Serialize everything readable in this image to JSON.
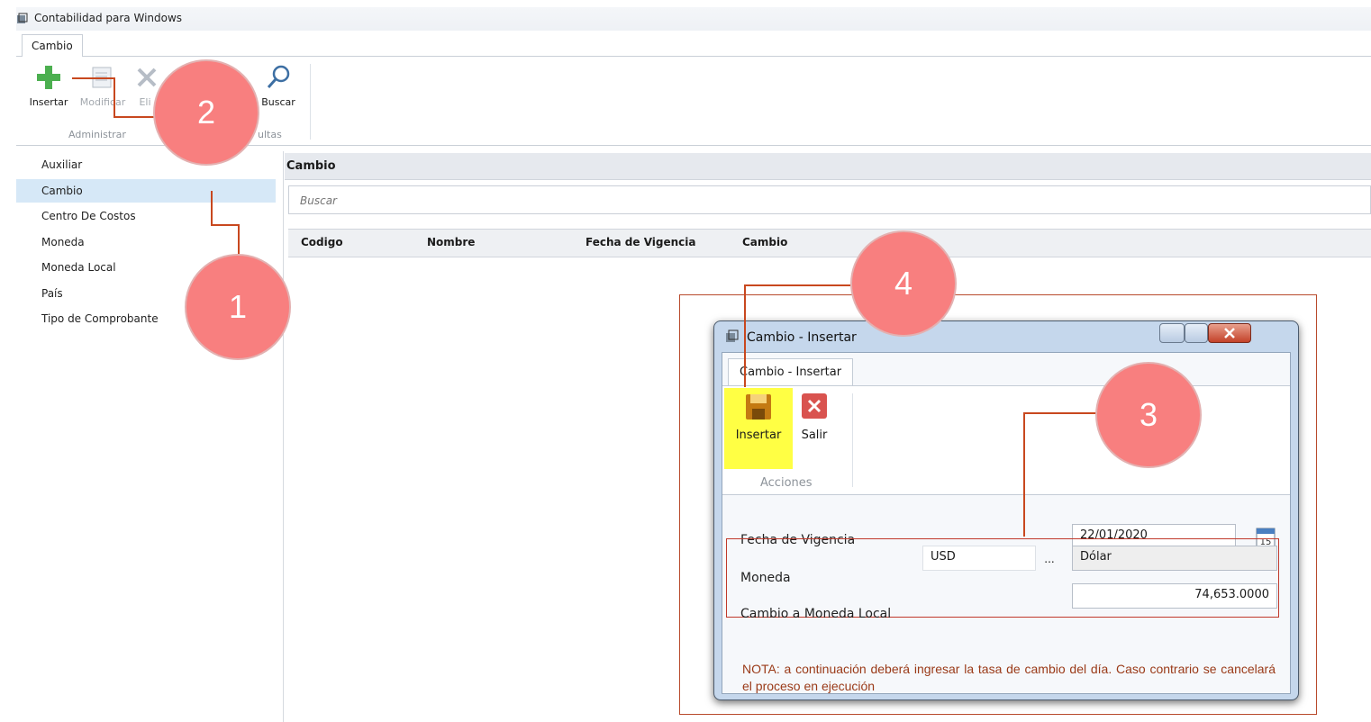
{
  "window": {
    "title": "Contabilidad para Windows"
  },
  "ribbon": {
    "tab": "Cambio",
    "buttons": {
      "insertar": "Insertar",
      "modificar": "Modificar",
      "eliminar": "Eli",
      "buscar": "Buscar"
    },
    "groups": {
      "administrar": "Administrar",
      "consultas": "ultas"
    }
  },
  "sidebar": {
    "items": [
      {
        "label": "Auxiliar"
      },
      {
        "label": "Cambio"
      },
      {
        "label": "Centro De Costos"
      },
      {
        "label": "Moneda"
      },
      {
        "label": "Moneda Local"
      },
      {
        "label": "País"
      },
      {
        "label": "Tipo de Comprobante"
      }
    ]
  },
  "main": {
    "header": "Cambio",
    "search_placeholder": "Buscar",
    "columns": [
      "Codigo",
      "Nombre",
      "Fecha de Vigencia",
      "Cambio"
    ]
  },
  "dialog": {
    "title": "Cambio - Insertar",
    "tab": "Cambio - Insertar",
    "actions": {
      "insertar": "Insertar",
      "salir": "Salir",
      "group": "Acciones"
    },
    "fecha_label": "Fecha de Vigencia",
    "fecha_value": "22/01/2020",
    "calendar_day": "15",
    "moneda_label": "Moneda",
    "moneda_code": "USD",
    "browse_label": "...",
    "moneda_name": "Dólar",
    "cambio_label": "Cambio a Moneda Local",
    "cambio_value": "74,653.0000",
    "note": "NOTA: a continuación deberá ingresar la tasa de cambio del día. Caso contrario se cancelará el proceso en ejecución"
  },
  "callouts": [
    "1",
    "2",
    "3",
    "4"
  ],
  "colors": {
    "callout_fill": "#f87f7f",
    "callout_line": "#c8481f",
    "highlight": "#ffff44",
    "selected_row": "#d6e8f7"
  }
}
